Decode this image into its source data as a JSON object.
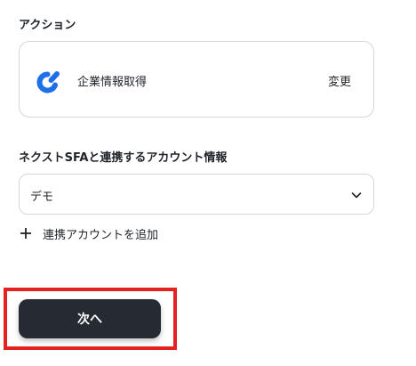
{
  "action_section": {
    "label": "アクション",
    "action_name": "企業情報取得",
    "change_label": "変更",
    "logo_icon": "company-info-logo-icon",
    "logo_color": "#1f6feb"
  },
  "account_section": {
    "label": "ネクストSFAと連携するアカウント情報",
    "selected_value": "デモ",
    "chevron_icon": "chevron-down-icon",
    "add_account_label": "連携アカウントを追加",
    "add_icon": "plus-icon"
  },
  "footer": {
    "next_label": "次へ",
    "next_button_color": "#262a33",
    "highlight_color": "#e42222"
  }
}
